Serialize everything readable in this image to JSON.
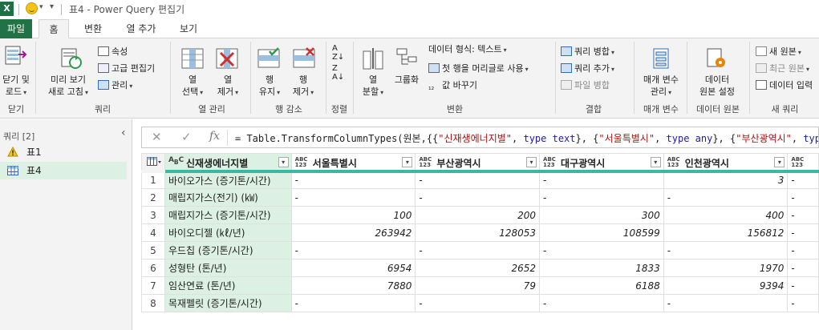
{
  "titlebar": {
    "app_icon": "X",
    "title": "표4 - Power Query 편집기"
  },
  "tabs": [
    "파일",
    "홈",
    "변환",
    "열 추가",
    "보기"
  ],
  "ribbon": {
    "close": {
      "line1": "닫기 및",
      "line2": "로드",
      "group": "닫기"
    },
    "refresh": {
      "line1": "미리 보기",
      "line2": "새로 고침",
      "properties": "속성",
      "advanced": "고급 편집기",
      "manage": "관리",
      "group": "쿼리"
    },
    "choose_cols": {
      "line1": "열",
      "line2": "선택"
    },
    "remove_cols": {
      "line1": "열",
      "line2": "제거",
      "group": "열 관리"
    },
    "keep_rows": {
      "line1": "행",
      "line2": "유지"
    },
    "remove_rows": {
      "line1": "행",
      "line2": "제거",
      "group": "행 감소"
    },
    "sort": {
      "group": "정렬"
    },
    "split": {
      "line1": "열",
      "line2": "분할"
    },
    "groupby": "그룹화",
    "transform": {
      "datatype": "데이터 형식: 텍스트",
      "header": "첫 행을 머리글로 사용",
      "replace": "값 바꾸기",
      "group": "변환"
    },
    "combine": {
      "merge": "쿼리 병합",
      "append": "쿼리 추가",
      "files": "파일 병합",
      "group": "결합"
    },
    "params": {
      "line1": "매개 변수",
      "line2": "관리",
      "group": "매개 변수"
    },
    "datasource": {
      "line1": "데이터",
      "line2": "원본 설정",
      "group": "데이터 원본"
    },
    "newquery": {
      "newsource": "새 원본",
      "recent": "최근 원본",
      "enter": "데이터 입력",
      "group": "새 쿼리"
    }
  },
  "queries": {
    "header": "쿼리 [2]",
    "items": [
      {
        "label": "표1",
        "icon": "warning-icon"
      },
      {
        "label": "표4",
        "icon": "table-icon"
      }
    ]
  },
  "formula": {
    "prefix": "= Table.TransformColumnTypes(원본,{{",
    "s1": "\"신재생에너지별\"",
    "t1": "type text",
    "s2": "\"서울특별시\"",
    "t2": "type any",
    "s3": "\"부산광역시\"",
    "t3": "type"
  },
  "table": {
    "columns": [
      {
        "name": "신재생에너지별",
        "type": "ABC"
      },
      {
        "name": "서울특별시",
        "type": "ABC123"
      },
      {
        "name": "부산광역시",
        "type": "ABC123"
      },
      {
        "name": "대구광역시",
        "type": "ABC123"
      },
      {
        "name": "인천광역시",
        "type": "ABC123"
      },
      {
        "name": "",
        "type": "ABC123"
      }
    ],
    "rows": [
      [
        "바이오가스 (증기톤/시간)",
        "-",
        "-",
        "-",
        "3",
        "-"
      ],
      [
        "매립지가스(전기) (㎾)",
        "-",
        "-",
        "-",
        "-",
        "-"
      ],
      [
        "매립지가스 (증기톤/시간)",
        "100",
        "200",
        "300",
        "400",
        "-"
      ],
      [
        "바이오디젤 (㎘/년)",
        "263942",
        "128053",
        "108599",
        "156812",
        "-"
      ],
      [
        "우드칩 (증기톤/시간)",
        "-",
        "-",
        "-",
        "-",
        "-"
      ],
      [
        "성형탄 (톤/년)",
        "6954",
        "2652",
        "1833",
        "1970",
        "-"
      ],
      [
        "임산연료 (톤/년)",
        "7880",
        "79",
        "6188",
        "9394",
        "-"
      ],
      [
        "목재펠릿 (증기톤/시간)",
        "-",
        "-",
        "-",
        "-",
        "-"
      ]
    ]
  }
}
